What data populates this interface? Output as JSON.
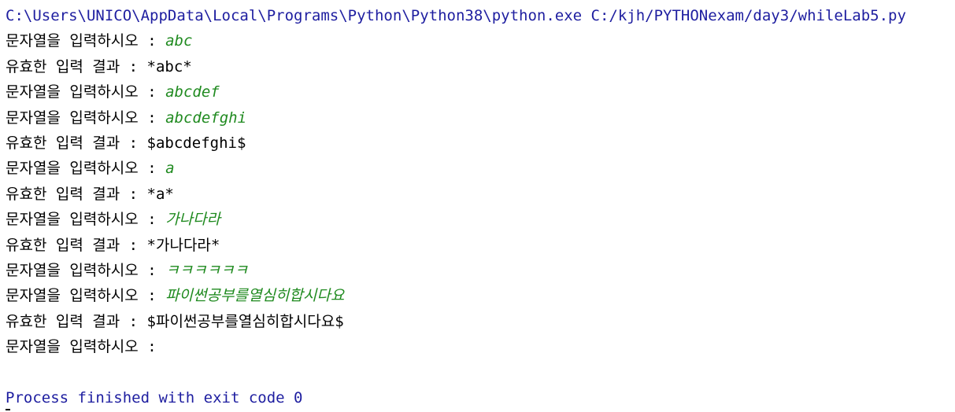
{
  "console": {
    "command": "C:\\Users\\UNICO\\AppData\\Local\\Programs\\Python\\Python38\\python.exe C:/kjh/PYTHONexam/day3/whileLab5.py",
    "lines": [
      {
        "prompt": "문자열을 입력하시오 : ",
        "input": "abc"
      },
      {
        "output": "유효한 입력 결과 : *abc*"
      },
      {
        "prompt": "문자열을 입력하시오 : ",
        "input": "abcdef"
      },
      {
        "prompt": "문자열을 입력하시오 : ",
        "input": "abcdefghi"
      },
      {
        "output": "유효한 입력 결과 : $abcdefghi$"
      },
      {
        "prompt": "문자열을 입력하시오 : ",
        "input": "a"
      },
      {
        "output": "유효한 입력 결과 : *a*"
      },
      {
        "prompt": "문자열을 입력하시오 : ",
        "input": "가나다라"
      },
      {
        "output": "유효한 입력 결과 : *가나다라*"
      },
      {
        "prompt": "문자열을 입력하시오 : ",
        "input": "ㅋㅋㅋㅋㅋㅋ"
      },
      {
        "prompt": "문자열을 입력하시오 : ",
        "input": "파이썬공부를열심히합시다요"
      },
      {
        "output": "유효한 입력 결과 : $파이썬공부를열심히합시다요$"
      },
      {
        "prompt": "문자열을 입력하시오 : ",
        "input": ""
      }
    ],
    "exit_message": "Process finished with exit code 0"
  },
  "colors": {
    "command": "#1e1ea0",
    "user_input": "#1f8a1f",
    "output": "#000000"
  }
}
